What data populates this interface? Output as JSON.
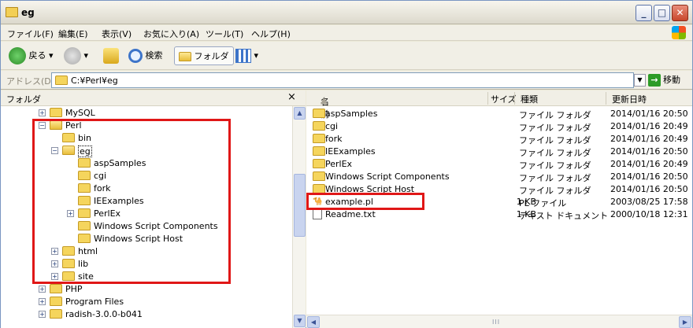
{
  "window": {
    "title": "eg"
  },
  "menu": [
    "ファイル(F)",
    "編集(E)",
    "表示(V)",
    "お気に入り(A)",
    "ツール(T)",
    "ヘルプ(H)"
  ],
  "toolbar": {
    "back": "戻る",
    "search": "検索",
    "folders": "フォルダ"
  },
  "address": {
    "label": "アドレス(D)",
    "value": "C:¥Perl¥eg",
    "go": "移動"
  },
  "leftpane": {
    "title": "フォルダ",
    "close": "×"
  },
  "tree": [
    {
      "label": "MySQL",
      "expander": "+"
    },
    {
      "label": "Perl",
      "expander": "−"
    },
    {
      "label": "bin",
      "expander": ""
    },
    {
      "label": "eg",
      "expander": "−"
    },
    {
      "label": "aspSamples",
      "expander": ""
    },
    {
      "label": "cgi",
      "expander": ""
    },
    {
      "label": "fork",
      "expander": ""
    },
    {
      "label": "IEExamples",
      "expander": ""
    },
    {
      "label": "PerlEx",
      "expander": "+"
    },
    {
      "label": "Windows Script Components",
      "expander": ""
    },
    {
      "label": "Windows Script Host",
      "expander": ""
    },
    {
      "label": "html",
      "expander": "+"
    },
    {
      "label": "lib",
      "expander": "+"
    },
    {
      "label": "site",
      "expander": "+"
    },
    {
      "label": "PHP",
      "expander": "+"
    },
    {
      "label": "Program Files",
      "expander": "+"
    },
    {
      "label": "radish-3.0.0-b041",
      "expander": "+"
    }
  ],
  "columns": {
    "name": "名前",
    "size": "サイズ",
    "type": "種類",
    "date": "更新日時"
  },
  "files": [
    {
      "name": "aspSamples",
      "size": "",
      "type": "ファイル フォルダ",
      "date": "2014/01/16 20:50",
      "kind": "folder"
    },
    {
      "name": "cgi",
      "size": "",
      "type": "ファイル フォルダ",
      "date": "2014/01/16 20:49",
      "kind": "folder"
    },
    {
      "name": "fork",
      "size": "",
      "type": "ファイル フォルダ",
      "date": "2014/01/16 20:49",
      "kind": "folder"
    },
    {
      "name": "IEExamples",
      "size": "",
      "type": "ファイル フォルダ",
      "date": "2014/01/16 20:50",
      "kind": "folder"
    },
    {
      "name": "PerlEx",
      "size": "",
      "type": "ファイル フォルダ",
      "date": "2014/01/16 20:49",
      "kind": "folder"
    },
    {
      "name": "Windows Script Components",
      "size": "",
      "type": "ファイル フォルダ",
      "date": "2014/01/16 20:50",
      "kind": "folder"
    },
    {
      "name": "Windows Script Host",
      "size": "",
      "type": "ファイル フォルダ",
      "date": "2014/01/16 20:50",
      "kind": "folder"
    },
    {
      "name": "example.pl",
      "size": "1 KB",
      "type": "PL ファイル",
      "date": "2003/08/25 17:58",
      "kind": "pl"
    },
    {
      "name": "Readme.txt",
      "size": "1 KB",
      "type": "テキスト ドキュメント",
      "date": "2000/10/18 12:31",
      "kind": "txt"
    }
  ],
  "colors": {
    "highlight": "#e01717",
    "folder": "#f5d55d"
  }
}
